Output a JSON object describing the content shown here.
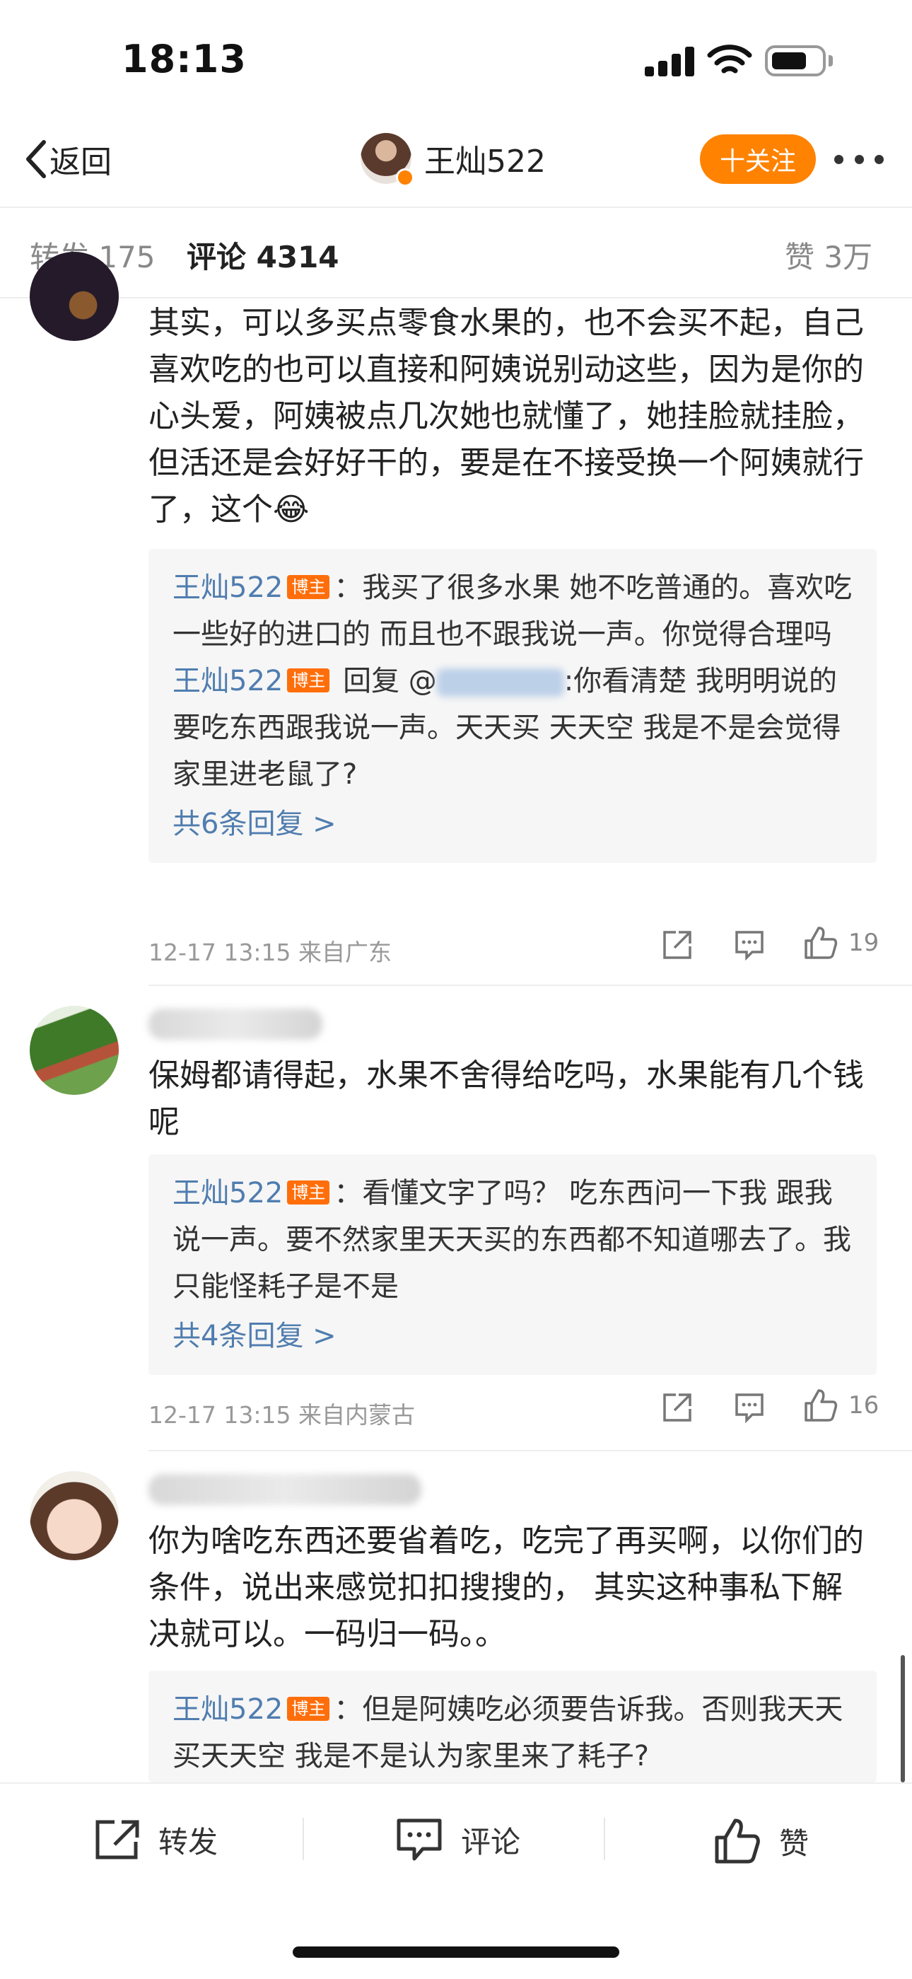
{
  "status_bar": {
    "time": "18:13"
  },
  "nav": {
    "back_label": "返回",
    "title": "王灿522",
    "follow_label": "十关注"
  },
  "tabs": {
    "reposts": "转发 175",
    "comments": "评论 4314",
    "likes": "赞 3万"
  },
  "comments": [
    {
      "text": "其实，可以多买点零食水果的，也不会买不起，自己喜欢吃的也可以直接和阿姨说别动这些，因为是你的心头爱，阿姨被点几次她也就懂了，她挂脸就挂脸，但活还是会好好干的，要是在不接受换一个阿姨就行了，这个😂",
      "replies": [
        {
          "author": "王灿522",
          "badge": "博主",
          "text": "：我买了很多水果 她不吃普通的。喜欢吃一些好的进口的 而且也不跟我说一声。你觉得合理吗"
        },
        {
          "author": "王灿522",
          "badge": "博主",
          "reply_word": " 回复 @",
          "text": ":你看清楚 我明明说的要吃东西跟我说一声。天天买 天天空 我是不是会觉得家里进老鼠了?"
        }
      ],
      "more_replies": "共6条回复 >",
      "time_location": "12-17 13:15  来自广东",
      "likes": "19"
    },
    {
      "text": "保姆都请得起，水果不舍得给吃吗，水果能有几个钱呢",
      "replies": [
        {
          "author": "王灿522",
          "badge": "博主",
          "text": "：看懂文字了吗？ 吃东西问一下我 跟我说一声。要不然家里天天买的东西都不知道哪去了。我只能怪耗子是不是"
        }
      ],
      "more_replies": "共4条回复 >",
      "time_location": "12-17 13:15  来自内蒙古",
      "likes": "16"
    },
    {
      "text": "你为啥吃东西还要省着吃，吃完了再买啊，以你们的条件，说出来感觉扣扣搜搜的，  其实这种事私下解决就可以。一码归一码。。",
      "replies": [
        {
          "author": "王灿522",
          "badge": "博主",
          "text": "：但是阿姨吃必须要告诉我。否则我天天买天天空 我是不是认为家里来了耗子?"
        }
      ]
    }
  ],
  "bottom_bar": {
    "repost": "转发",
    "comment": "评论",
    "like": "赞"
  },
  "colors": {
    "accent_orange": "#ff8200",
    "link_blue": "#507daf",
    "badge_orange": "#ff6e0a"
  }
}
